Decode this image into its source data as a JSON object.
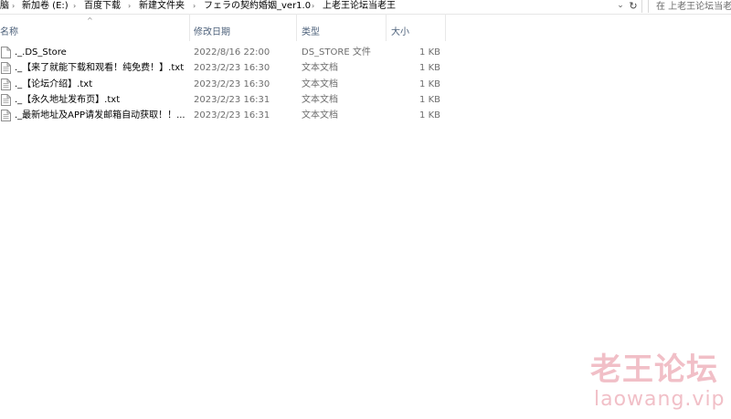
{
  "address_bar": {
    "crumbs": [
      {
        "label": "脑"
      },
      {
        "label": "新加卷 (E:)"
      },
      {
        "label": "百度下载"
      },
      {
        "label": "新建文件夹"
      },
      {
        "label": "フェラの契約婚姻_ver1.0"
      },
      {
        "label": "上老王论坛当老王"
      }
    ],
    "search_placeholder": "在 上老王论坛当老王"
  },
  "columns": {
    "name": "名称",
    "date": "修改日期",
    "type": "类型",
    "size": "大小"
  },
  "files": [
    {
      "name": "._.DS_Store",
      "date": "2022/8/16 22:00",
      "type": "DS_STORE 文件",
      "size": "1 KB"
    },
    {
      "name": "._【来了就能下载和观看！纯免费！】.txt",
      "date": "2023/2/23 16:30",
      "type": "文本文档",
      "size": "1 KB"
    },
    {
      "name": "._【论坛介绍】.txt",
      "date": "2023/2/23 16:30",
      "type": "文本文档",
      "size": "1 KB"
    },
    {
      "name": "._【永久地址发布页】.txt",
      "date": "2023/2/23 16:31",
      "type": "文本文档",
      "size": "1 KB"
    },
    {
      "name": "._最新地址及APP请发邮箱自动获取！！...",
      "date": "2023/2/23 16:31",
      "type": "文本文档",
      "size": "1 KB"
    }
  ],
  "watermark": {
    "cn": "老王论坛",
    "en": "laowang.vip"
  },
  "colors": {
    "header_text": "#4c607a",
    "muted_text": "#6d6d6d",
    "watermark": "#ecaab4"
  }
}
